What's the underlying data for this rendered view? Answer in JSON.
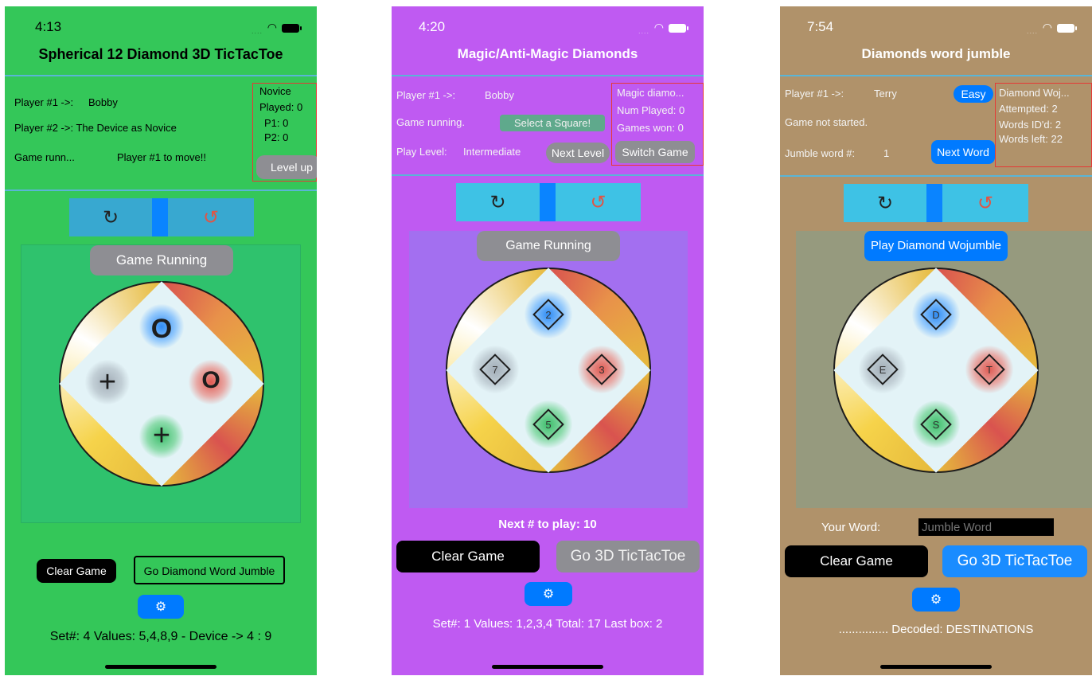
{
  "screens": [
    {
      "time": "4:13",
      "title": "Spherical 12 Diamond 3D TicTacToe",
      "p1_label": "Player #1 ->:",
      "p1_name": "Bobby",
      "p2_label": "Player #2 ->: The Device as Novice",
      "status": "Game runn...",
      "move": "Player #1 to move!!",
      "box": {
        "level": "Novice",
        "played": "Played: 0",
        "p1": "P1: 0",
        "p2": "P2: 0"
      },
      "level_up": "Level up",
      "rotate_icon": "↻",
      "undo_icon": "↺",
      "game_state": "Game Running",
      "marks": [
        "O",
        "+",
        "O",
        "+"
      ],
      "clear": "Clear Game",
      "go": "Go Diamond Word Jumble",
      "gear_icon": "⚙",
      "footer": "Set#: 4 Values: 5,4,8,9  - Device -> 4 : 9"
    },
    {
      "time": "4:20",
      "title": "Magic/Anti-Magic Diamonds",
      "p1_label": "Player #1 ->:",
      "p1_name": "Bobby",
      "status": "Game running.",
      "select": "Select a Square!",
      "level_label": "Play Level:",
      "level_value": "Intermediate",
      "next_level": "Next Level",
      "box": {
        "name": "Magic diamo...",
        "played": "Num Played: 0",
        "won": "Games won: 0"
      },
      "switch": "Switch Game",
      "rotate_icon": "↻",
      "undo_icon": "↺",
      "game_state": "Game Running",
      "marks": [
        "2",
        "7",
        "3",
        "5"
      ],
      "next_num": "Next # to play: 10",
      "clear": "Clear Game",
      "go": "Go 3D TicTacToe",
      "gear_icon": "⚙",
      "footer": "Set#: 1 Values: 1,2,3,4   Total: 17 Last box: 2"
    },
    {
      "time": "7:54",
      "title": "Diamonds word jumble",
      "p1_label": "Player #1 ->:",
      "p1_name": "Terry",
      "easy": "Easy",
      "status": "Game not started.",
      "jumble_label": "Jumble word #:",
      "jumble_num": "1",
      "next_word": "Next Word",
      "box": {
        "name": "Diamond Woj...",
        "attempted": "Attempted: 2",
        "ids": "Words ID'd: 2",
        "left": "Words left: 22"
      },
      "rotate_icon": "↻",
      "undo_icon": "↺",
      "play": "Play Diamond Wojumble",
      "marks": [
        "D",
        "E",
        "T",
        "S"
      ],
      "your_word": "Your Word:",
      "word_placeholder": "Jumble Word",
      "clear": "Clear Game",
      "go": "Go 3D TicTacToe",
      "gear_icon": "⚙",
      "footer": "............... Decoded: DESTINATIONS"
    }
  ]
}
